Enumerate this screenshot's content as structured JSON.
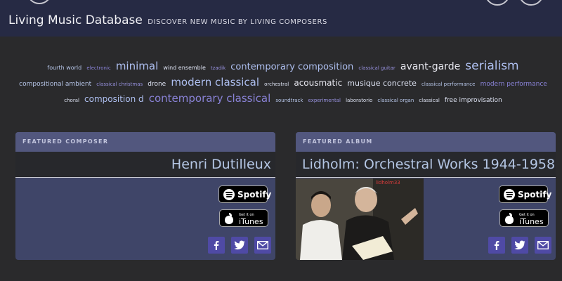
{
  "header": {
    "title": "Living Music Database",
    "subtitle": "DISCOVER NEW MUSIC BY LIVING COMPOSERS"
  },
  "tag_cloud": [
    {
      "text": "fourth world",
      "size": 8,
      "color": "#b6c5e8"
    },
    {
      "text": "electronic",
      "size": 7,
      "color": "#8a83d8"
    },
    {
      "text": "minimal",
      "size": 15,
      "color": "#aebff0"
    },
    {
      "text": "wind ensemble",
      "size": 8,
      "color": "#dde2f2"
    },
    {
      "text": "tzadik",
      "size": 7,
      "color": "#9892e0"
    },
    {
      "text": "contemporary composition",
      "size": 13,
      "color": "#aebff0"
    },
    {
      "text": "classical guitar",
      "size": 7,
      "color": "#9892e0"
    },
    {
      "text": "avant-garde",
      "size": 14,
      "color": "#e6e6ee"
    },
    {
      "text": "serialism",
      "size": 17,
      "color": "#aebff0"
    },
    {
      "text": "compositional ambient",
      "size": 9,
      "color": "#b6c5e8"
    },
    {
      "text": "classical christmas",
      "size": 7,
      "color": "#9892e0"
    },
    {
      "text": "drone",
      "size": 9,
      "color": "#dde2f2"
    },
    {
      "text": "modern classical",
      "size": 15,
      "color": "#aebff0"
    },
    {
      "text": "orchestral",
      "size": 7,
      "color": "#dde2f2"
    },
    {
      "text": "acousmatic",
      "size": 12,
      "color": "#e6e6ee"
    },
    {
      "text": "musique concrete",
      "size": 11,
      "color": "#dde2f2"
    },
    {
      "text": "classical performance",
      "size": 7,
      "color": "#b6c5e8"
    },
    {
      "text": "modern performance",
      "size": 9,
      "color": "#8a83d8"
    },
    {
      "text": "choral",
      "size": 7,
      "color": "#dde2f2"
    },
    {
      "text": "composition d",
      "size": 12,
      "color": "#aebff0"
    },
    {
      "text": "contemporary classical",
      "size": 15,
      "color": "#8a83d8"
    },
    {
      "text": "soundtrack",
      "size": 7,
      "color": "#b6c5e8"
    },
    {
      "text": "experimental",
      "size": 7,
      "color": "#9892e0"
    },
    {
      "text": "laboratorio",
      "size": 7,
      "color": "#dde2f2"
    },
    {
      "text": "classical organ",
      "size": 7,
      "color": "#b6c5e8"
    },
    {
      "text": "classical",
      "size": 7,
      "color": "#dde2f2"
    },
    {
      "text": "free improvisation",
      "size": 9,
      "color": "#dde2f2"
    }
  ],
  "featured_composer": {
    "label": "FEATURED COMPOSER",
    "name": "Henri Dutilleux"
  },
  "featured_album": {
    "label": "FEATURED ALBUM",
    "title": "Lidholm: Orchestral Works 1944-1958",
    "cover_tag": "lidholm33"
  },
  "badges": {
    "spotify": "Spotify",
    "itunes_small": "Get it on",
    "itunes": "iTunes"
  },
  "social_icons": [
    "facebook-icon",
    "twitter-icon",
    "email-icon"
  ],
  "colors": {
    "header_bg": "#262a44",
    "card_bg": "#3f4568",
    "card_head_bg": "#52577e",
    "social_bg": "#4f4aa5",
    "name_color": "#b4c6e4"
  }
}
